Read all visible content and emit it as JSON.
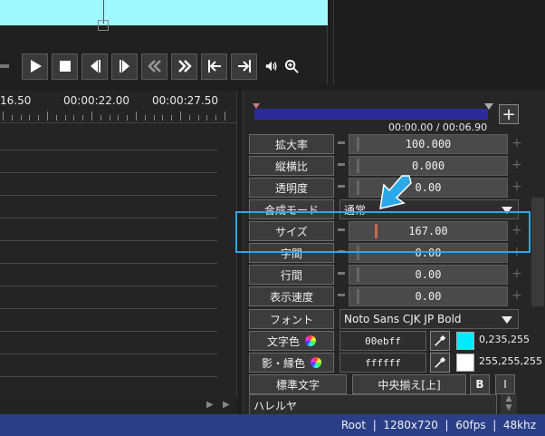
{
  "transport": {
    "buttons": [
      "play-icon",
      "stop-icon",
      "step-back-icon",
      "step-forward-icon",
      "rewind-icon",
      "fast-forward-icon",
      "jump-start-icon",
      "jump-end-icon"
    ],
    "extras": [
      "volume-icon",
      "zoom-icon"
    ]
  },
  "timeline": {
    "ruler_labels": [
      "16.50",
      "00:00:22.00",
      "00:00:27.50"
    ]
  },
  "playback": {
    "progress": 0.0,
    "timecode": "00:00.00 / 00:06.90",
    "add_label": "+"
  },
  "properties": {
    "scale": {
      "label": "拡大率",
      "value": "100.000"
    },
    "aspect": {
      "label": "縦横比",
      "value": "0.000"
    },
    "opacity": {
      "label": "透明度",
      "value": "0.00"
    },
    "blend": {
      "label": "合成モード",
      "value": "通常"
    },
    "size": {
      "label": "サイズ",
      "value": "167.00"
    },
    "char_spacing": {
      "label": "字間",
      "value": "0.00"
    },
    "line_spacing": {
      "label": "行間",
      "value": "0.00"
    },
    "display_speed": {
      "label": "表示速度",
      "value": "0.00"
    },
    "font": {
      "label": "フォント",
      "value": "Noto Sans CJK JP Bold"
    },
    "text_color": {
      "label": "文字色",
      "hex": "00ebff",
      "rgb": "0,235,255",
      "swatch": "#00ebff"
    },
    "shadow_color": {
      "label": "影・縁色",
      "hex": "ffffff",
      "rgb": "255,255,255",
      "swatch": "#ffffff"
    },
    "standard_text": "標準文字",
    "align": "中央揃え[上]",
    "bold": "B",
    "italic": "I",
    "text_content": "ハレルヤ"
  },
  "status": {
    "text": "Root  |  1280x720  |  60fps  |  48khz"
  },
  "colors": {
    "accent": "#2aa8e8",
    "statusbar": "#2a3f87",
    "seekbar": "#3a3ae8",
    "preview": "#a0f8ff"
  }
}
